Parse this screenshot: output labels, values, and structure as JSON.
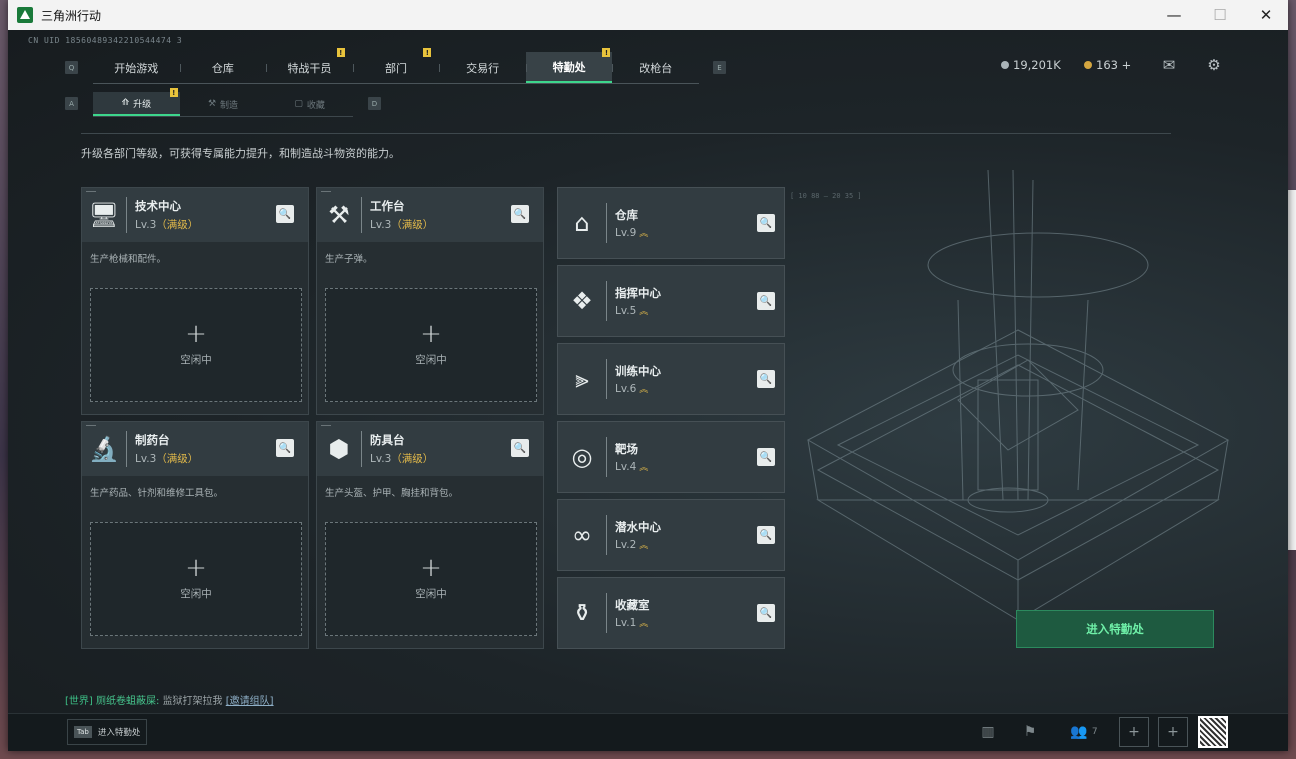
{
  "window": {
    "title": "三角洲行动"
  },
  "uid": "CN UID 18560489342210544474 3",
  "top_tabs": [
    {
      "label": "开始游戏",
      "badge": ""
    },
    {
      "label": "仓库",
      "badge": ""
    },
    {
      "label": "特战干员",
      "badge": "!"
    },
    {
      "label": "部门",
      "badge": "!"
    },
    {
      "label": "交易行",
      "badge": ""
    },
    {
      "label": "特勤处",
      "badge": "!"
    },
    {
      "label": "改枪台",
      "badge": ""
    }
  ],
  "key_hints": {
    "left": "Q",
    "right": "E",
    "sub_left": "A",
    "sub_right": "D"
  },
  "currency": {
    "coins": "19,201K",
    "tokens": "163 +"
  },
  "sub_tabs": [
    {
      "label": "升级",
      "badge": "!"
    },
    {
      "label": "制造",
      "badge": ""
    },
    {
      "label": "收藏",
      "badge": ""
    }
  ],
  "description": "升级各部门等级，可获得专属能力提升，和制造战斗物资的能力。",
  "workshops": [
    {
      "name": "技术中心",
      "level": "Lv.3",
      "max": "（满级）",
      "desc": "生产枪械和配件。",
      "slot_plus": "+",
      "slot_status": "空闲中",
      "icon": "monitor-icon"
    },
    {
      "name": "工作台",
      "level": "Lv.3",
      "max": "（满级）",
      "desc": "生产子弹。",
      "slot_plus": "+",
      "slot_status": "空闲中",
      "icon": "tools-icon"
    },
    {
      "name": "制药台",
      "level": "Lv.3",
      "max": "（满级）",
      "desc": "生产药品、针剂和维修工具包。",
      "slot_plus": "+",
      "slot_status": "空闲中",
      "icon": "microscope-icon"
    },
    {
      "name": "防具台",
      "level": "Lv.3",
      "max": "（满级）",
      "desc": "生产头盔、护甲、胸挂和背包。",
      "slot_plus": "+",
      "slot_status": "空闲中",
      "icon": "cubes-icon"
    }
  ],
  "facilities": [
    {
      "name": "仓库",
      "level": "Lv.9",
      "icon": "warehouse-icon"
    },
    {
      "name": "指挥中心",
      "level": "Lv.5",
      "icon": "command-icon"
    },
    {
      "name": "训练中心",
      "level": "Lv.6",
      "icon": "dumbbell-icon"
    },
    {
      "name": "靶场",
      "level": "Lv.4",
      "icon": "target-icon"
    },
    {
      "name": "潜水中心",
      "level": "Lv.2",
      "icon": "goggles-icon"
    },
    {
      "name": "收藏室",
      "level": "Lv.1",
      "icon": "trophy-icon"
    }
  ],
  "upgrade_glyph": "︽",
  "search_glyph": "🔍",
  "enter_button": "进入特勤处",
  "chat": {
    "channel": "[世界]",
    "user": "厕纸卷蛆蔽屎:",
    "message": "监狱打架拉我",
    "link": "[邀请组队]"
  },
  "tab_hint": {
    "key": "Tab",
    "label": "进入特勤处"
  },
  "friends_count": "7",
  "deco_readout": "[ 10 88 — 20 35 ]",
  "colors": {
    "accent": "#3dd68c",
    "gold": "#e0b84a",
    "badge": "#e8c33c"
  }
}
